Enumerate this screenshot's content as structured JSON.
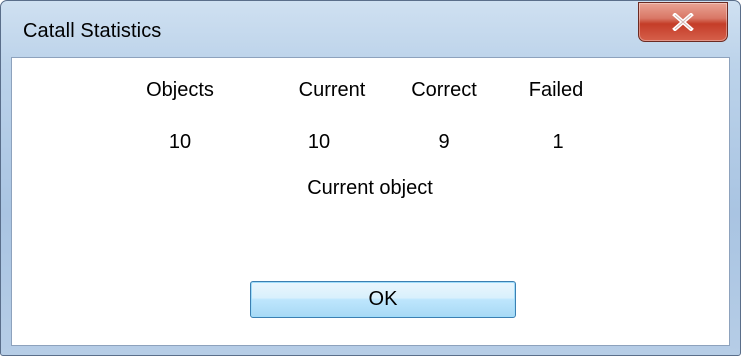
{
  "window": {
    "title": "Catall Statistics"
  },
  "stats": {
    "headers": [
      "Objects",
      "Current",
      "Correct",
      "Failed"
    ],
    "values": [
      "10",
      "10",
      "9",
      "1"
    ]
  },
  "status_label": "Current object",
  "ok_label": "OK"
}
